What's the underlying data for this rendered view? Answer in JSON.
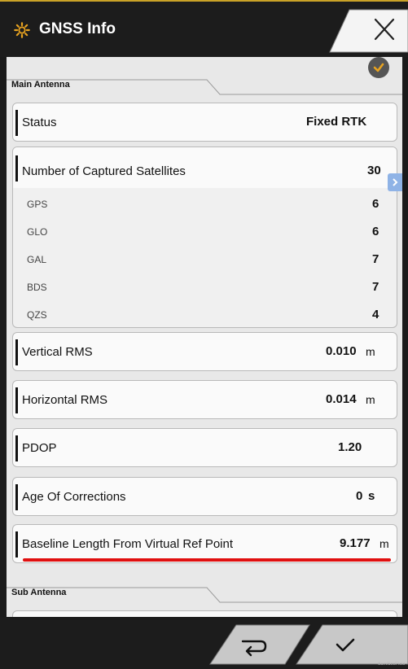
{
  "header": {
    "title": "GNSS Info",
    "icon": "gear-icon"
  },
  "main_antenna": {
    "section_label": "Main Antenna",
    "status": {
      "label": "Status",
      "value": "Fixed RTK"
    },
    "satellites": {
      "label": "Number of Captured Satellites",
      "value": "30",
      "items": [
        {
          "label": "GPS",
          "value": "6"
        },
        {
          "label": "GLO",
          "value": "6"
        },
        {
          "label": "GAL",
          "value": "7"
        },
        {
          "label": "BDS",
          "value": "7"
        },
        {
          "label": "QZS",
          "value": "4"
        }
      ]
    },
    "vertical_rms": {
      "label": "Vertical RMS",
      "value": "0.010",
      "unit": "m"
    },
    "horizontal_rms": {
      "label": "Horizontal RMS",
      "value": "0.014",
      "unit": "m"
    },
    "pdop": {
      "label": "PDOP",
      "value": "1.20"
    },
    "age_of_corrections": {
      "label": "Age Of Corrections",
      "value": "0",
      "unit": "s"
    },
    "baseline_length": {
      "label": "Baseline Length From Virtual Ref Point",
      "value": "9.177",
      "unit": "m"
    }
  },
  "sub_antenna": {
    "section_label": "Sub Antenna"
  },
  "footer": {
    "corner_text": "Barn/Sec/Field"
  },
  "colors": {
    "accent": "#c9a227",
    "highlight_underline": "#e01010",
    "badge": "#e8a320"
  }
}
